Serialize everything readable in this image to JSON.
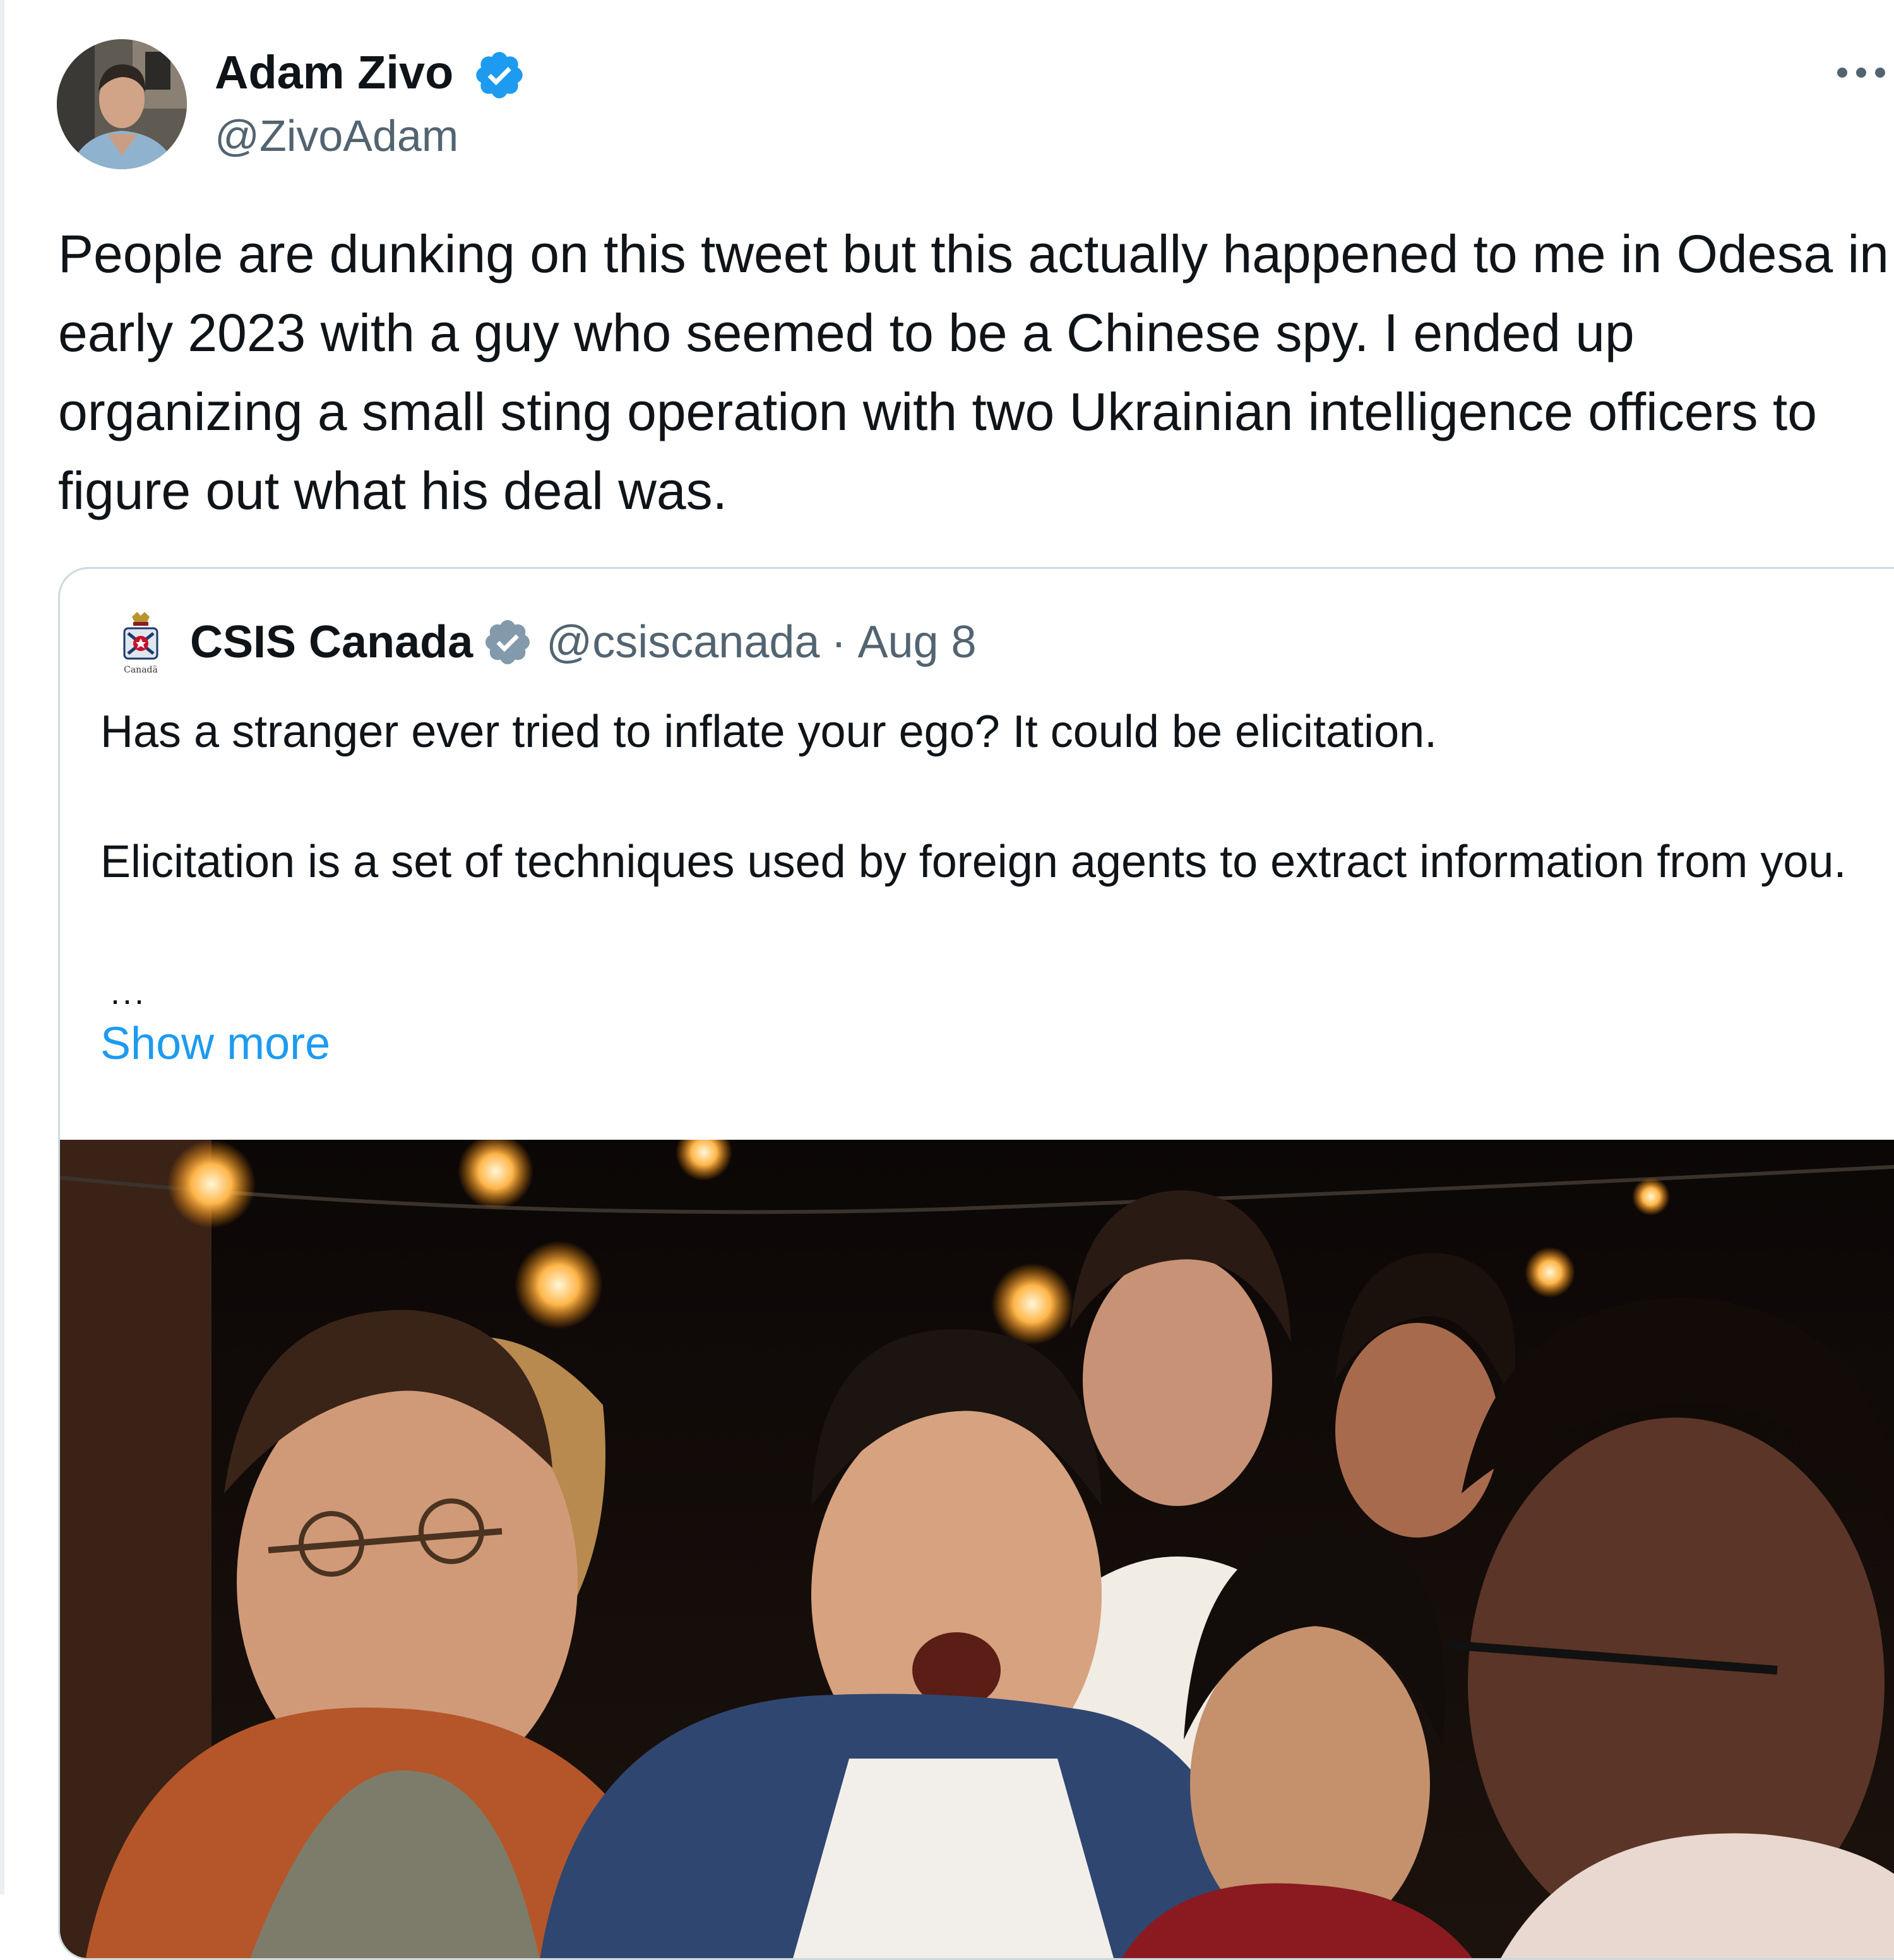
{
  "tweet": {
    "author_name": "Adam Zivo",
    "author_handle": "@ZivoAdam",
    "text": "People are dunking on this tweet but this actually happened to me in Odesa in early 2023 with a guy who seemed to be a Chinese spy. I ended up organizing a small sting operation with two Ukrainian intelligence officers to figure out what his deal was.",
    "more_icon": "more-dots-icon",
    "verified_icon": "verified-badge-icon",
    "accent_color": "#1d9bf0"
  },
  "quote": {
    "author_name": "CSIS Canada",
    "author_handle": "@csiscanada",
    "separator": "·",
    "date": "Aug 8",
    "paragraph_1": "Has a stranger ever tried to inflate your ego? It could be elicitation.",
    "paragraph_2": "Elicitation is a set of techniques used by foreign agents to extract information from you.",
    "ellipsis": "...",
    "show_more": "Show more",
    "verified_icon": "verified-government-badge-icon",
    "logo_icon": "csis-logo-icon",
    "logo_caption": "Canadä"
  }
}
